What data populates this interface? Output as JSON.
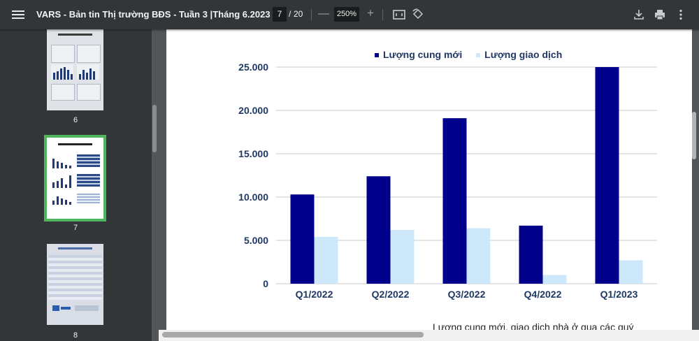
{
  "toolbar": {
    "title": "VARS - Bản tin Thị trường BĐS - Tuần 3 |Tháng 6.2023",
    "current_page": "7",
    "page_sep": "/",
    "total_pages": "20",
    "zoom": "250%",
    "zoom_minus": "—",
    "zoom_plus": "+",
    "icons": [
      "menu-icon",
      "fit-page-icon",
      "rotate-icon",
      "download-icon",
      "print-icon",
      "more-vert-icon"
    ]
  },
  "sidebar": {
    "thumbnails": [
      {
        "label": "6",
        "selected": false
      },
      {
        "label": "7",
        "selected": true
      },
      {
        "label": "8",
        "selected": false
      }
    ]
  },
  "chart_data": {
    "type": "bar",
    "title": "",
    "xlabel": "",
    "ylabel": "",
    "categories": [
      "Q1/2022",
      "Q2/2022",
      "Q3/2022",
      "Q4/2022",
      "Q1/2023"
    ],
    "series": [
      {
        "name": "Lượng cung mới",
        "color": "#00008b",
        "values": [
          10300,
          12400,
          19100,
          6700,
          25000
        ]
      },
      {
        "name": "Lượng giao dịch",
        "color": "#cde8fb",
        "values": [
          5400,
          6200,
          6400,
          1000,
          2700
        ]
      }
    ],
    "ylim": [
      0,
      25000
    ],
    "yticks": [
      "0",
      "5.000",
      "10.000",
      "15.000",
      "20.000",
      "25.000"
    ],
    "ytick_values": [
      0,
      5000,
      10000,
      15000,
      20000,
      25000
    ],
    "grid": true,
    "legend_position": "top"
  },
  "caption": "Lượng cung mới, giao dịch nhà ở qua các quý"
}
